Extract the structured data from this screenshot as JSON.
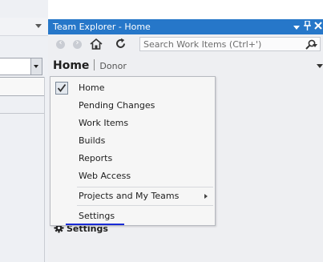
{
  "team_explorer": {
    "title": "Team Explorer - Home",
    "search_placeholder": "Search Work Items (Ctrl+')",
    "page_title": "Home",
    "page_context": "Donor",
    "settings_link": "Settings"
  },
  "nav_menu": {
    "items": [
      {
        "label": "Home",
        "checked": true
      },
      {
        "label": "Pending Changes"
      },
      {
        "label": "Work Items"
      },
      {
        "label": "Builds"
      },
      {
        "label": "Reports"
      },
      {
        "label": "Web Access"
      },
      {
        "label": "Projects and My Teams",
        "has_submenu": true
      },
      {
        "label": "Settings"
      }
    ]
  },
  "icons": {
    "title_bar": [
      "dropdown-icon",
      "pin-icon",
      "close-icon"
    ],
    "toolbar": [
      "back-icon",
      "forward-icon",
      "home-icon",
      "refresh-icon",
      "search-icon"
    ],
    "settings": "gear-icon"
  },
  "colors": {
    "title_bar": "#2677c9",
    "panel_background": "#eeeff2",
    "menu_background": "#f6f6f6",
    "highlight_underline": "#1a2bd6"
  }
}
